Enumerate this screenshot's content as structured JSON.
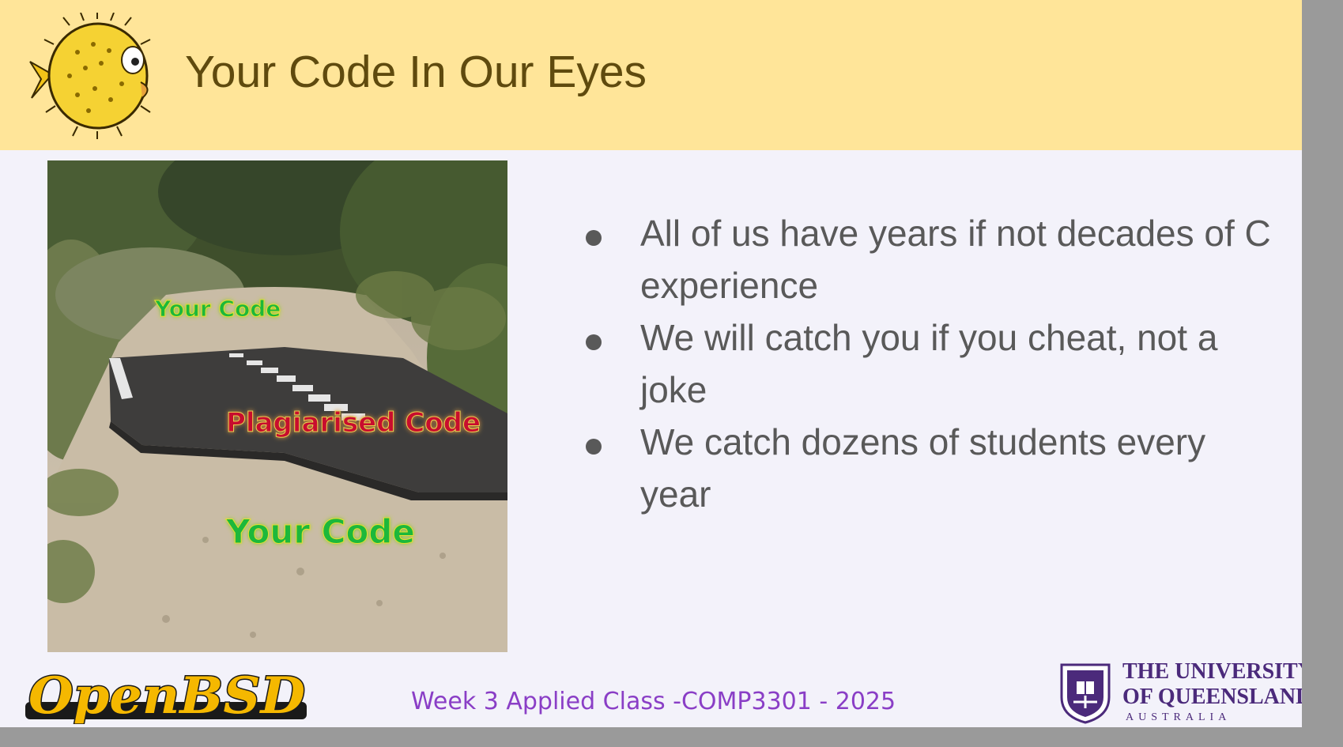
{
  "slide": {
    "title": "Your Code In Our Eyes",
    "bullets": [
      "All of us have years if not decades of C experience",
      "We will catch you if you cheat, not a joke",
      "We catch dozens of students every year"
    ],
    "footer": "Week 3 Applied Class -COMP3301 - 2025"
  },
  "image": {
    "label_top": "Your Code",
    "label_middle": "Plagiarised  Code",
    "label_bottom": "Your Code"
  },
  "logos": {
    "openbsd_text": "OpenBSD",
    "uq_line1": "THE UNIVERSITY",
    "uq_line2": "OF QUEENSLAND",
    "uq_line3": "AUSTRALIA"
  },
  "colors": {
    "header_bg": "#ffe599",
    "title": "#5f4a0e",
    "body_text": "#595959",
    "footer_text": "#8a3ec6",
    "uq_purple": "#4b2a7b"
  },
  "icons": [
    "puffer-fish-icon",
    "openbsd-logo",
    "uq-crest-icon"
  ]
}
